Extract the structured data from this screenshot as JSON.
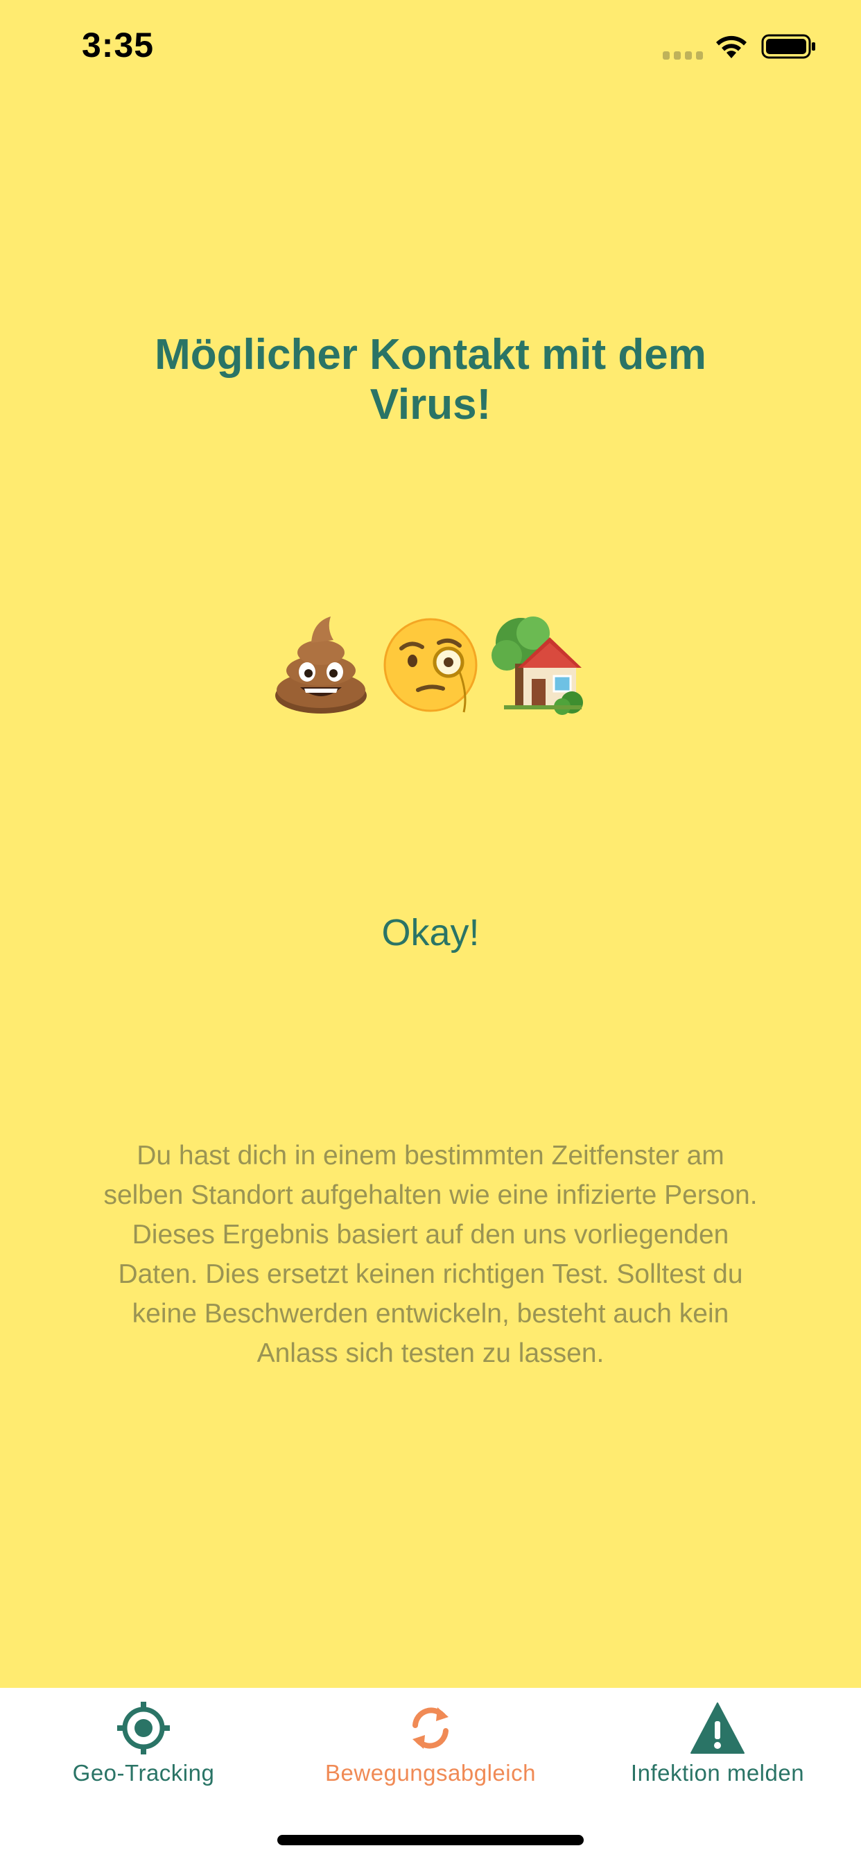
{
  "status_bar": {
    "time": "3:35"
  },
  "alert": {
    "title": "Möglicher Kontakt mit dem Virus!",
    "emojis": [
      "pile-of-poo",
      "face-with-monocle",
      "house-with-garden"
    ],
    "confirm_label": "Okay!",
    "description": "Du hast dich in einem bestimmten Zeitfenster am selben Standort aufgehalten wie eine infizierte Person. Dieses Ergebnis basiert auf den uns vorliegenden Daten. Dies ersetzt keinen richtigen Test. Solltest du keine Beschwerden entwickeln, besteht auch kein Anlass sich testen zu lassen."
  },
  "tab_bar": {
    "tabs": [
      {
        "label": "Geo-Tracking",
        "icon": "crosshair-icon",
        "active": false
      },
      {
        "label": "Bewegungsabgleich",
        "icon": "sync-icon",
        "active": true
      },
      {
        "label": "Infektion melden",
        "icon": "warning-icon",
        "active": false
      }
    ]
  },
  "colors": {
    "background": "#FFEB70",
    "primary": "#2A7466",
    "accent": "#F08A55",
    "body_text": "#9A9453",
    "tab_bar_bg": "#FFFFFF"
  }
}
